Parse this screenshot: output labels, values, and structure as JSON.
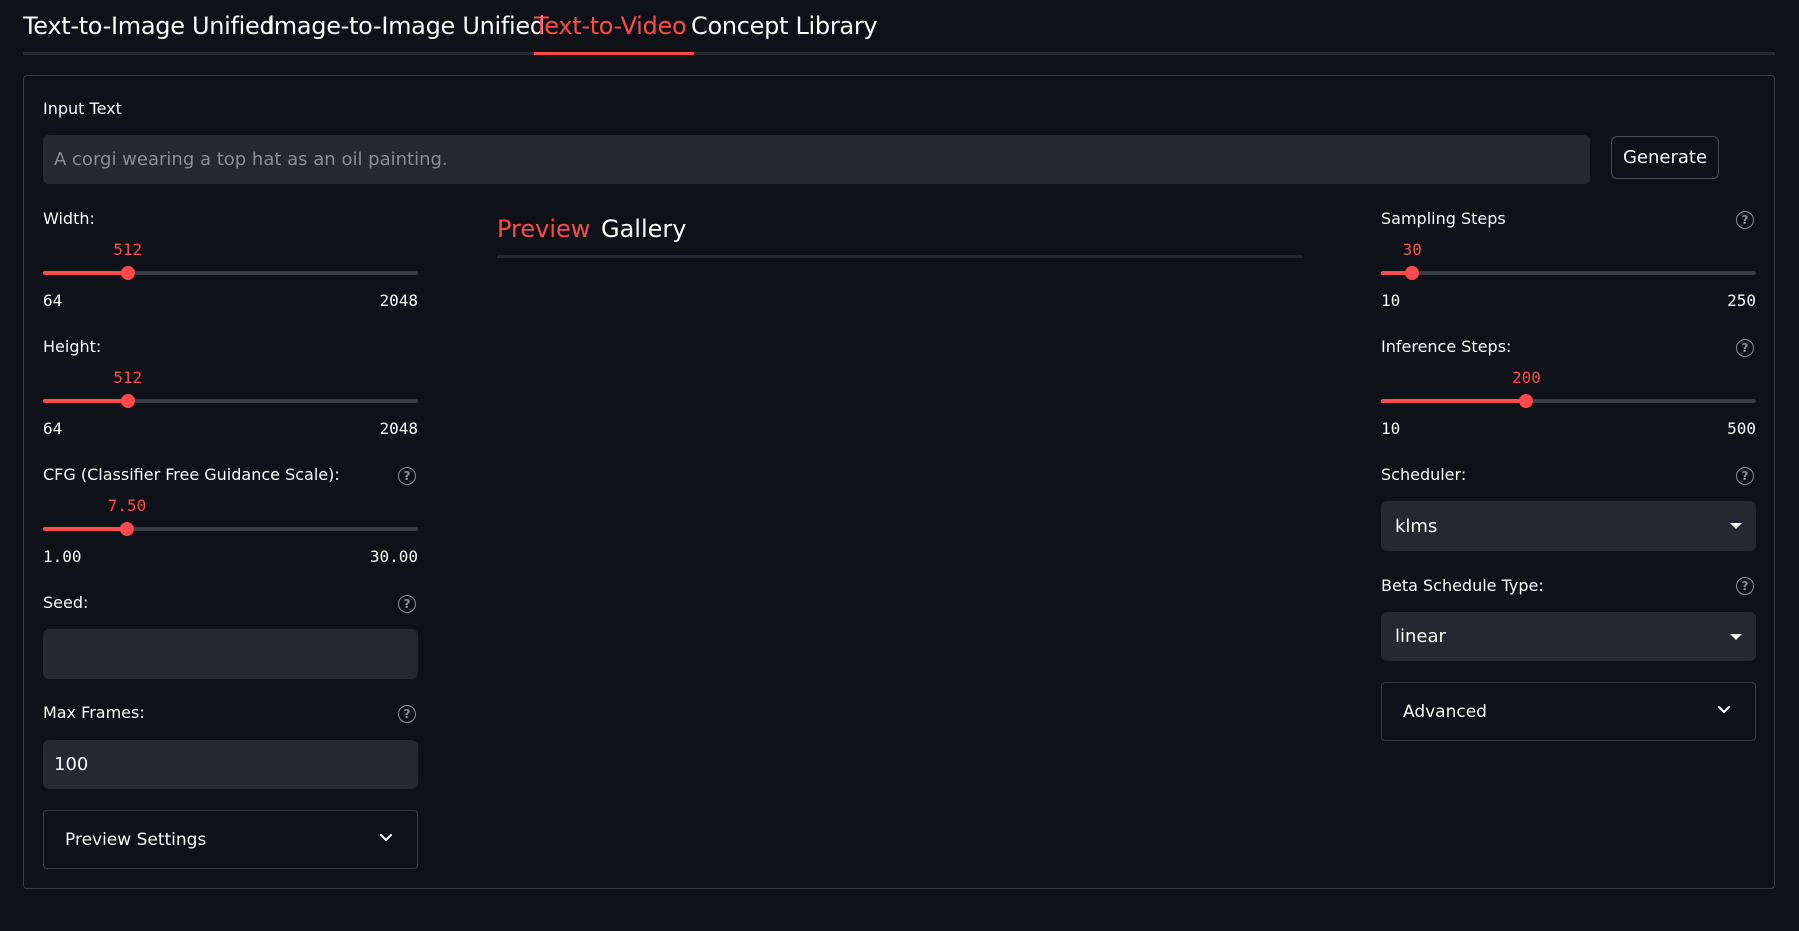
{
  "top_tabs": [
    {
      "label": "Text-to-Image Unified"
    },
    {
      "label": "Image-to-Image Unified"
    },
    {
      "label": "Text-to-Video",
      "active": true
    },
    {
      "label": "Concept Library"
    }
  ],
  "input": {
    "label": "Input Text",
    "placeholder": "A corgi wearing a top hat as an oil painting.",
    "value": ""
  },
  "generate_button": "Generate",
  "left": {
    "width": {
      "label": "Width:",
      "value": "512",
      "min": "64",
      "max": "2048",
      "fraction": 0.2258
    },
    "height": {
      "label": "Height:",
      "value": "512",
      "min": "64",
      "max": "2048",
      "fraction": 0.2258
    },
    "cfg": {
      "label": "CFG (Classifier Free Guidance Scale):",
      "value": "7.50",
      "min": "1.00",
      "max": "30.00",
      "fraction": 0.2241
    },
    "seed": {
      "label": "Seed:",
      "value": ""
    },
    "max_frames": {
      "label": "Max Frames:",
      "value": "100"
    },
    "preview_settings": "Preview Settings"
  },
  "center": {
    "tabs": [
      {
        "label": "Preview",
        "active": true
      },
      {
        "label": "Gallery"
      }
    ]
  },
  "right": {
    "sampling_steps": {
      "label": "Sampling Steps",
      "value": "30",
      "min": "10",
      "max": "250",
      "fraction": 0.0833
    },
    "inference_steps": {
      "label": "Inference Steps:",
      "value": "200",
      "min": "10",
      "max": "500",
      "fraction": 0.3878
    },
    "scheduler": {
      "label": "Scheduler:",
      "value": "klms"
    },
    "beta_schedule": {
      "label": "Beta Schedule Type:",
      "value": "linear"
    },
    "advanced": "Advanced"
  },
  "colors": {
    "accent": "#ff4b4b",
    "background": "#0e1117",
    "input_bg": "#262730"
  },
  "icons": {
    "help": "question-circle-icon",
    "expand": "chevron-down-icon",
    "select_caret": "caret-down-icon"
  }
}
